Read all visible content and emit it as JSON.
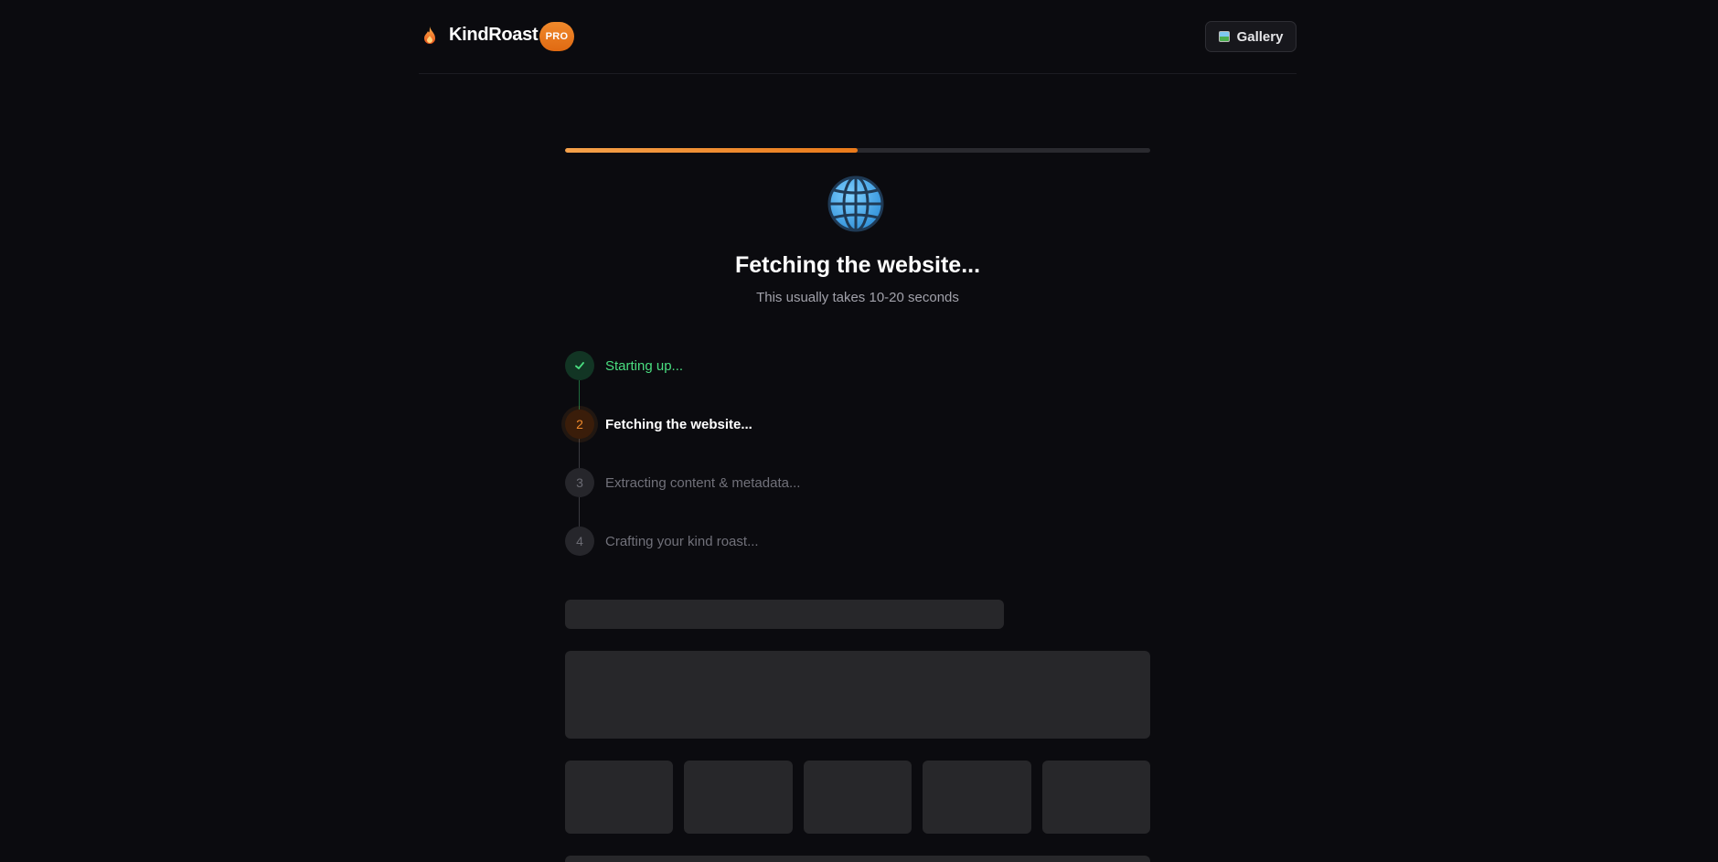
{
  "header": {
    "brand": "KindRoast",
    "badge": "PRO",
    "gallery_label": "Gallery"
  },
  "progress": {
    "fraction": 0.5
  },
  "main": {
    "title": "Fetching the website...",
    "subtitle": "This usually takes 10-20 seconds"
  },
  "steps": [
    {
      "marker": "",
      "label": "Starting up...",
      "state": "done"
    },
    {
      "marker": "2",
      "label": "Fetching the website...",
      "state": "active"
    },
    {
      "marker": "3",
      "label": "Extracting content & metadata...",
      "state": "pending"
    },
    {
      "marker": "4",
      "label": "Crafting your kind roast...",
      "state": "pending"
    }
  ],
  "colors": {
    "background": "#0b0b0f",
    "accent": "#ea7a1a",
    "success": "#4ade80",
    "skeleton": "#27272a"
  },
  "icons": {
    "logo": "flame-icon",
    "gallery": "picture-icon",
    "stage": "globe-icon",
    "done": "check-icon"
  }
}
